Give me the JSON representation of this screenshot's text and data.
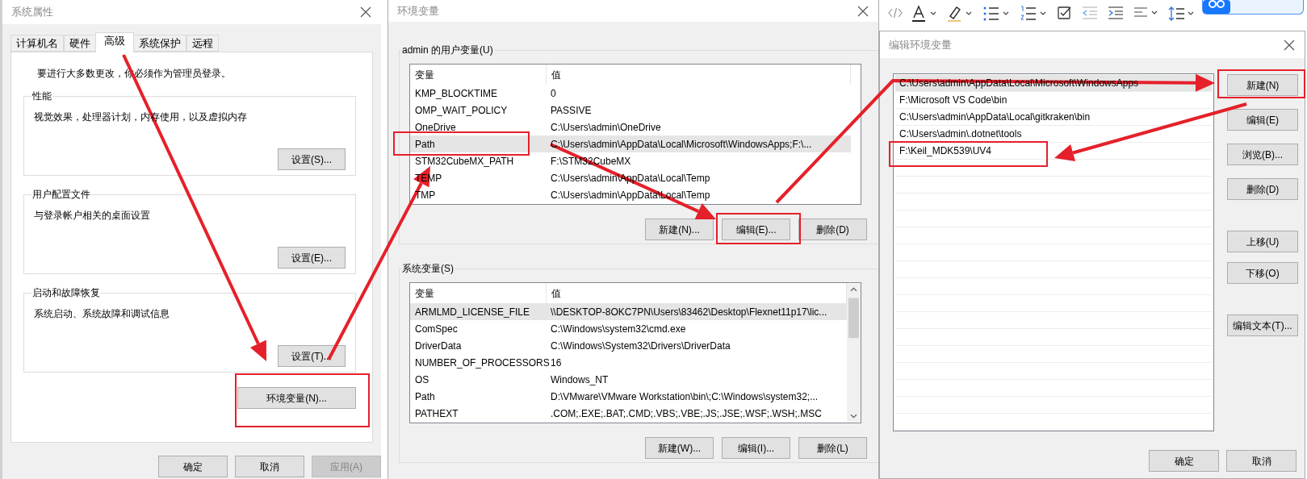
{
  "system_properties": {
    "title": "系统属性",
    "tabs": [
      {
        "label": "计算机名",
        "selected": false
      },
      {
        "label": "硬件",
        "selected": false
      },
      {
        "label": "高级",
        "selected": true
      },
      {
        "label": "系统保护",
        "selected": false
      },
      {
        "label": "远程",
        "selected": false
      }
    ],
    "notice": "要进行大多数更改，你必须作为管理员登录。",
    "groups": [
      {
        "title": "性能",
        "description": "视觉效果，处理器计划，内存使用，以及虚拟内存",
        "button": "设置(S)..."
      },
      {
        "title": "用户配置文件",
        "description": "与登录帐户相关的桌面设置",
        "button": "设置(E)..."
      },
      {
        "title": "启动和故障恢复",
        "description": "系统启动、系统故障和调试信息",
        "button": "设置(T)..."
      }
    ],
    "env_button": "环境变量(N)...",
    "buttons": [
      {
        "label": "确定",
        "disabled": false
      },
      {
        "label": "取消",
        "disabled": false
      },
      {
        "label": "应用(A)",
        "disabled": true
      }
    ]
  },
  "environment_variables": {
    "title": "环境变量",
    "user_variables": {
      "title": "admin 的用户变量(U)",
      "columns": [
        "变量",
        "值"
      ],
      "rows": [
        {
          "name": "KMP_BLOCKTIME",
          "value": "0",
          "selected": false
        },
        {
          "name": "OMP_WAIT_POLICY",
          "value": "PASSIVE",
          "selected": false
        },
        {
          "name": "OneDrive",
          "value": "C:\\Users\\admin\\OneDrive",
          "selected": false
        },
        {
          "name": "Path",
          "value": "C:\\Users\\admin\\AppData\\Local\\Microsoft\\WindowsApps;F:\\...",
          "selected": true
        },
        {
          "name": "STM32CubeMX_PATH",
          "value": "F:\\STM32CubeMX",
          "selected": false
        },
        {
          "name": "TEMP",
          "value": "C:\\Users\\admin\\AppData\\Local\\Temp",
          "selected": false
        },
        {
          "name": "TMP",
          "value": "C:\\Users\\admin\\AppData\\Local\\Temp",
          "selected": false
        }
      ],
      "buttons": [
        "新建(N)...",
        "编辑(E)...",
        "删除(D)"
      ]
    },
    "system_variables": {
      "title": "系统变量(S)",
      "columns": [
        "变量",
        "值"
      ],
      "rows": [
        {
          "name": "ARMLMD_LICENSE_FILE",
          "value": "\\\\DESKTOP-8OKC7PN\\Users\\83462\\Desktop\\Flexnet11p17\\lic...",
          "selected": true
        },
        {
          "name": "ComSpec",
          "value": "C:\\Windows\\system32\\cmd.exe",
          "selected": false
        },
        {
          "name": "DriverData",
          "value": "C:\\Windows\\System32\\Drivers\\DriverData",
          "selected": false
        },
        {
          "name": "NUMBER_OF_PROCESSORS",
          "value": "16",
          "selected": false
        },
        {
          "name": "OS",
          "value": "Windows_NT",
          "selected": false
        },
        {
          "name": "Path",
          "value": "D:\\VMware\\VMware Workstation\\bin\\;C:\\Windows\\system32;...",
          "selected": false
        },
        {
          "name": "PATHEXT",
          "value": ".COM;.EXE;.BAT;.CMD;.VBS;.VBE;.JS;.JSE;.WSF;.WSH;.MSC",
          "selected": false
        }
      ],
      "buttons": [
        "新建(W)...",
        "编辑(I)...",
        "删除(L)"
      ]
    }
  },
  "edit_environment_variable": {
    "title": "编辑环境变量",
    "entries": [
      {
        "text": "C:\\Users\\admin\\AppData\\Local\\Microsoft\\WindowsApps",
        "selected": true
      },
      {
        "text": "F:\\Microsoft VS Code\\bin",
        "selected": false
      },
      {
        "text": "C:\\Users\\admin\\AppData\\Local\\gitkraken\\bin",
        "selected": false
      },
      {
        "text": "C:\\Users\\admin\\.dotnet\\tools",
        "selected": false
      },
      {
        "text": "F:\\Keil_MDK539\\UV4",
        "selected": false
      }
    ],
    "side_buttons": [
      [
        "新建(N)",
        "编辑(E)",
        "浏览(B)...",
        "删除(D)"
      ],
      [
        "上移(U)",
        "下移(O)"
      ],
      [
        "编辑文本(T)..."
      ]
    ],
    "buttons": [
      "确定",
      "取消"
    ]
  }
}
